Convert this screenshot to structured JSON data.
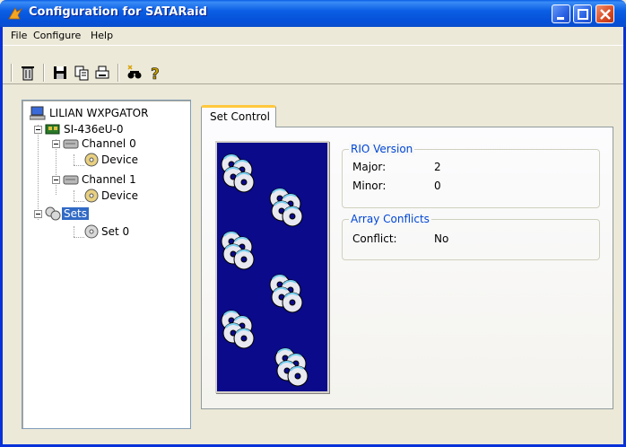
{
  "window": {
    "title": "Configuration for SATARaid"
  },
  "menu": {
    "items": [
      {
        "label": "File"
      },
      {
        "label": "Configure"
      },
      {
        "label": "Help"
      }
    ]
  },
  "toolbar": {
    "icons": [
      "trash-icon",
      "save-icon",
      "copy-icon",
      "print-icon",
      "find-icon",
      "help-icon"
    ]
  },
  "tree": {
    "root": "LILIAN WXPGATOR",
    "controller": "SI-436eU-0",
    "channel0": "Channel 0",
    "channel0_device": "Device",
    "channel1": "Channel 1",
    "channel1_device": "Device",
    "sets": "Sets",
    "set0": "Set 0"
  },
  "tabs": {
    "active": "Set Control"
  },
  "rio": {
    "title": "RIO Version",
    "major_label": "Major:",
    "major_value": "2",
    "minor_label": "Minor:",
    "minor_value": "0"
  },
  "conflicts": {
    "title": "Array Conflicts",
    "conflict_label": "Conflict:",
    "conflict_value": "No"
  },
  "colors": {
    "titlebar": "#0a5ee6",
    "selection": "#316ac5",
    "group_title": "#0046d5",
    "art_background": "#0a0a8a",
    "tab_highlight": "#ffc83c"
  }
}
